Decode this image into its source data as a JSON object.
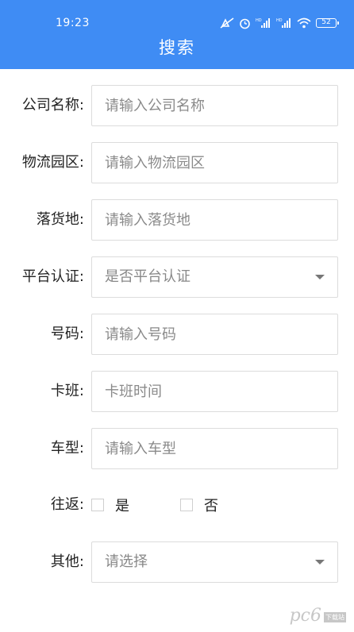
{
  "status_bar": {
    "time": "19:23",
    "battery": "52",
    "signal_label_1": "HD",
    "signal_label_2": "HD"
  },
  "header": {
    "title": "搜索"
  },
  "form": {
    "company_name": {
      "label": "公司名称:",
      "placeholder": "请输入公司名称"
    },
    "logistics_park": {
      "label": "物流园区:",
      "placeholder": "请输入物流园区"
    },
    "destination": {
      "label": "落货地:",
      "placeholder": "请输入落货地"
    },
    "platform_cert": {
      "label": "平台认证:",
      "value": "是否平台认证"
    },
    "number": {
      "label": "号码:",
      "placeholder": "请输入号码"
    },
    "schedule": {
      "label": "卡班:",
      "placeholder": "卡班时间"
    },
    "vehicle_type": {
      "label": "车型:",
      "placeholder": "请输入车型"
    },
    "round_trip": {
      "label": "往返:",
      "option_yes": "是",
      "option_no": "否"
    },
    "other": {
      "label": "其他:",
      "value": "请选择"
    }
  },
  "watermark": {
    "text": "pc6",
    "sub": "下载站"
  },
  "colors": {
    "header_bg": "#3f8cf4",
    "border": "#dcdcdc"
  }
}
